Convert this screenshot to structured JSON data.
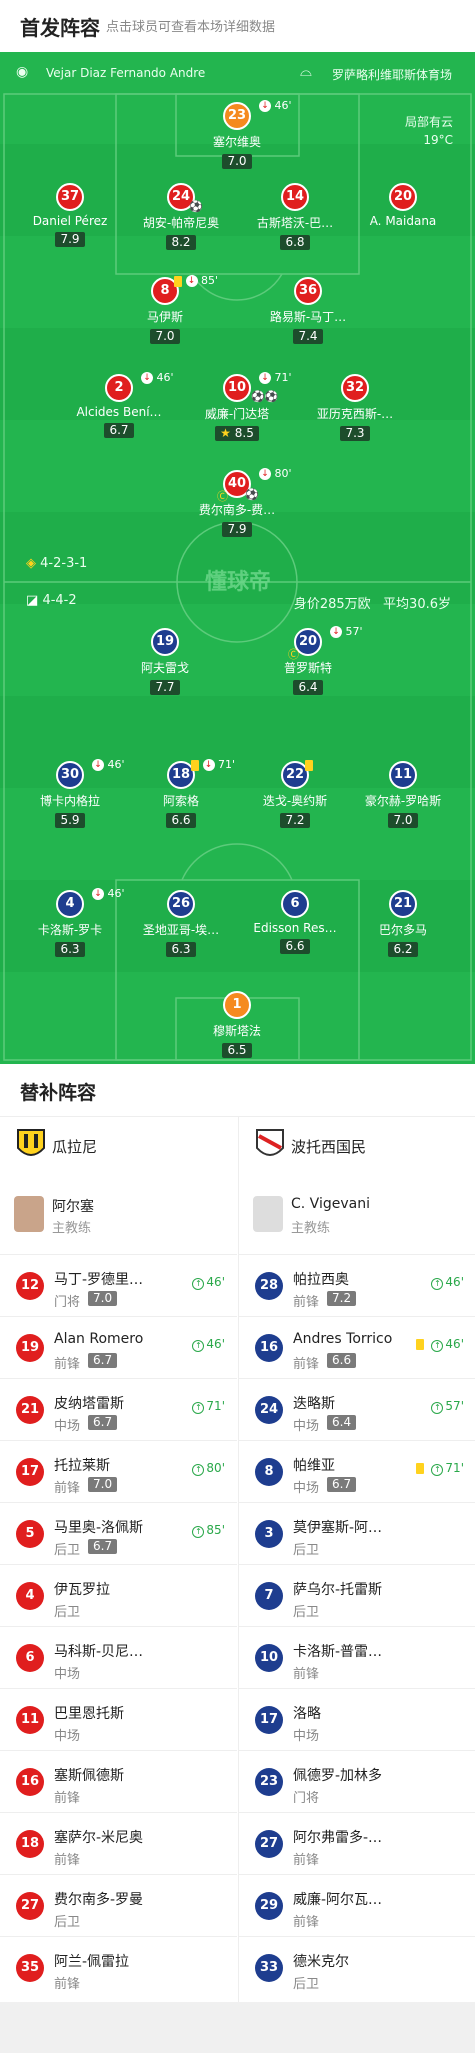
{
  "header": {
    "title": "首发阵容",
    "subtitle": "点击球员可查看本场详细数据"
  },
  "match_info": {
    "referee": "Vejar Diaz Fernando Andre",
    "venue": "罗萨略利维耶斯体育场",
    "weather": "局部有云",
    "temperature": "19°C"
  },
  "home": {
    "formation": "4-2-3-1",
    "players": [
      {
        "num": "23",
        "name": "塞尔维奥",
        "rating": "7.0",
        "event": "46'",
        "color": "orange"
      },
      {
        "num": "37",
        "name": "Daniel Pérez",
        "rating": "7.9"
      },
      {
        "num": "24",
        "name": "胡安-帕帝尼奥",
        "rating": "8.2"
      },
      {
        "num": "14",
        "name": "古斯塔沃-巴…",
        "rating": "6.8"
      },
      {
        "num": "20",
        "name": "A. Maidana",
        "rating": ""
      },
      {
        "num": "8",
        "name": "马伊斯",
        "rating": "7.0",
        "event": "85'"
      },
      {
        "num": "36",
        "name": "路易斯-马丁…",
        "rating": "7.4"
      },
      {
        "num": "2",
        "name": "Alcides Bení…",
        "rating": "6.7",
        "event": "46'"
      },
      {
        "num": "10",
        "name": "威廉-门达塔",
        "rating": "8.5",
        "event": "71'"
      },
      {
        "num": "32",
        "name": "亚历克西斯-…",
        "rating": "7.3"
      },
      {
        "num": "40",
        "name": "费尔南多-费…",
        "rating": "7.9",
        "event": "80'"
      }
    ]
  },
  "away": {
    "formation": "4-4-2",
    "value": "身价285万欧",
    "avg_age": "平均30.6岁",
    "players": [
      {
        "num": "19",
        "name": "阿夫雷戈",
        "rating": "7.7"
      },
      {
        "num": "20",
        "name": "普罗斯特",
        "rating": "6.4",
        "event": "57'"
      },
      {
        "num": "30",
        "name": "博卡内格拉",
        "rating": "5.9",
        "event": "46'"
      },
      {
        "num": "18",
        "name": "阿索格",
        "rating": "6.6",
        "event": "71'"
      },
      {
        "num": "22",
        "name": "迭戈-奥约斯",
        "rating": "7.2"
      },
      {
        "num": "11",
        "name": "豪尔赫-罗哈斯",
        "rating": "7.0"
      },
      {
        "num": "4",
        "name": "卡洛斯-罗卡",
        "rating": "6.3",
        "event": "46'"
      },
      {
        "num": "26",
        "name": "圣地亚哥-埃…",
        "rating": "6.3"
      },
      {
        "num": "6",
        "name": "Edisson Res…",
        "rating": "6.6"
      },
      {
        "num": "21",
        "name": "巴尔多马",
        "rating": "6.2"
      },
      {
        "num": "1",
        "name": "穆斯塔法",
        "rating": "6.5",
        "color": "orange"
      }
    ]
  },
  "subs": {
    "title": "替补阵容",
    "home_team": "瓜拉尼",
    "away_team": "波托西国民",
    "home_coach": {
      "name": "阿尔塞",
      "role": "主教练"
    },
    "away_coach": {
      "name": "C. Vigevani",
      "role": "主教练"
    },
    "home_list": [
      {
        "num": "12",
        "name": "马丁-罗德里…",
        "pos": "门将",
        "rating": "7.0",
        "in": "46'"
      },
      {
        "num": "19",
        "name": "Alan Romero",
        "pos": "前锋",
        "rating": "6.7",
        "in": "46'"
      },
      {
        "num": "21",
        "name": "皮纳塔雷斯",
        "pos": "中场",
        "rating": "6.7",
        "in": "71'"
      },
      {
        "num": "17",
        "name": "托拉莱斯",
        "pos": "前锋",
        "rating": "7.0",
        "in": "80'"
      },
      {
        "num": "5",
        "name": "马里奥-洛佩斯",
        "pos": "后卫",
        "rating": "6.7",
        "in": "85'"
      },
      {
        "num": "4",
        "name": "伊瓦罗拉",
        "pos": "后卫"
      },
      {
        "num": "6",
        "name": "马科斯-贝尼…",
        "pos": "中场"
      },
      {
        "num": "11",
        "name": "巴里恩托斯",
        "pos": "中场"
      },
      {
        "num": "16",
        "name": "塞斯佩德斯",
        "pos": "前锋"
      },
      {
        "num": "18",
        "name": "塞萨尔-米尼奥",
        "pos": "前锋"
      },
      {
        "num": "27",
        "name": "费尔南多-罗曼",
        "pos": "后卫"
      },
      {
        "num": "35",
        "name": "阿兰-佩雷拉",
        "pos": "前锋"
      }
    ],
    "away_list": [
      {
        "num": "28",
        "name": "帕拉西奥",
        "pos": "前锋",
        "rating": "7.2",
        "in": "46'"
      },
      {
        "num": "16",
        "name": "Andres Torrico",
        "pos": "前锋",
        "rating": "6.6",
        "in": "46'",
        "yellow": true
      },
      {
        "num": "24",
        "name": "迭略斯",
        "pos": "中场",
        "rating": "6.4",
        "in": "57'"
      },
      {
        "num": "8",
        "name": "帕维亚",
        "pos": "中场",
        "rating": "6.7",
        "in": "71'",
        "yellow": true
      },
      {
        "num": "3",
        "name": "莫伊塞斯-阿…",
        "pos": "后卫"
      },
      {
        "num": "7",
        "name": "萨乌尔-托雷斯",
        "pos": "后卫"
      },
      {
        "num": "10",
        "name": "卡洛斯-普雷…",
        "pos": "前锋"
      },
      {
        "num": "17",
        "name": "洛略",
        "pos": "中场"
      },
      {
        "num": "23",
        "name": "佩德罗-加林多",
        "pos": "门将"
      },
      {
        "num": "27",
        "name": "阿尔弗雷多-…",
        "pos": "前锋"
      },
      {
        "num": "29",
        "name": "威廉-阿尔瓦…",
        "pos": "前锋"
      },
      {
        "num": "33",
        "name": "德米克尔",
        "pos": "后卫"
      }
    ]
  },
  "colors": {
    "pitch": "#1fae4a",
    "home": "#e01e1e",
    "away": "#1e3d8f",
    "gk": "#f58a1f"
  }
}
